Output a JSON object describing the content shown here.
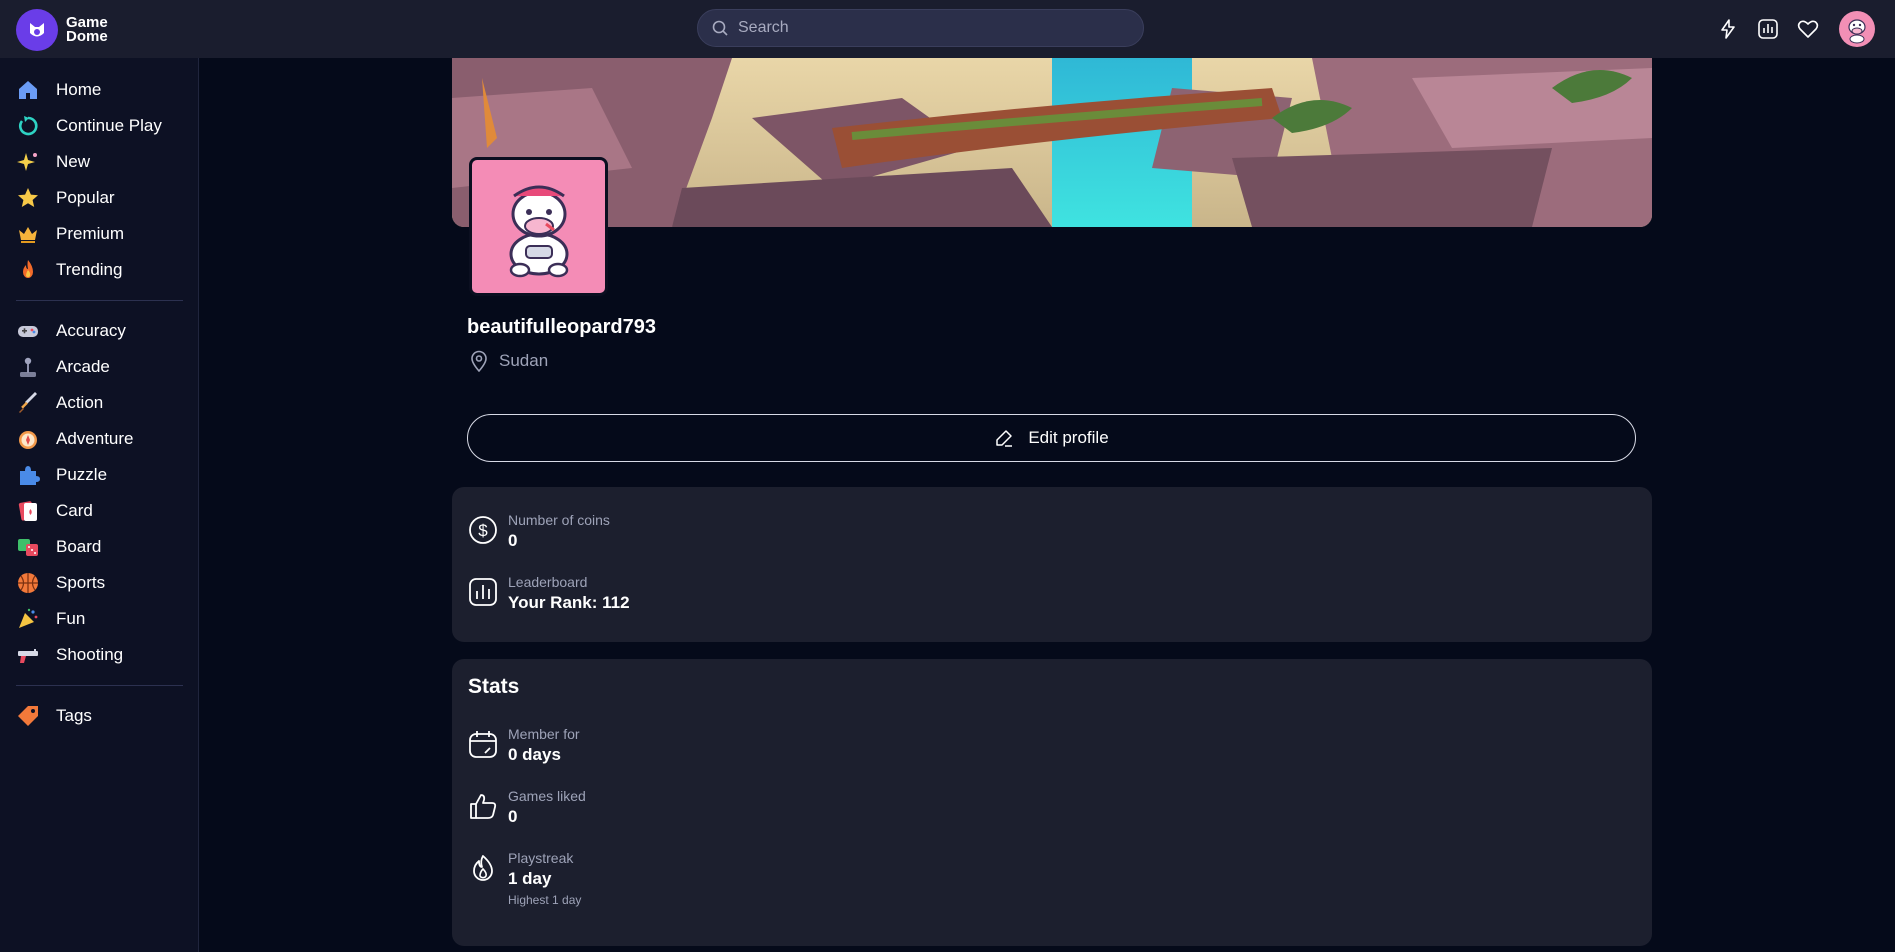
{
  "header": {
    "logo_text": "Game\nDome",
    "search_placeholder": "Search",
    "icons": [
      "lightning-icon",
      "chart-icon",
      "heart-icon",
      "avatar"
    ]
  },
  "sidebar": {
    "primary": [
      {
        "label": "Home",
        "icon": "home-icon"
      },
      {
        "label": "Continue Play",
        "icon": "continue-play-icon"
      },
      {
        "label": "New",
        "icon": "sparkle-icon"
      },
      {
        "label": "Popular",
        "icon": "star-icon"
      },
      {
        "label": "Premium",
        "icon": "crown-icon"
      },
      {
        "label": "Trending",
        "icon": "fire-icon"
      }
    ],
    "categories": [
      {
        "label": "Accuracy",
        "icon": "gamepad-icon"
      },
      {
        "label": "Arcade",
        "icon": "joystick-icon"
      },
      {
        "label": "Action",
        "icon": "sword-icon"
      },
      {
        "label": "Adventure",
        "icon": "compass-icon"
      },
      {
        "label": "Puzzle",
        "icon": "puzzle-icon"
      },
      {
        "label": "Card",
        "icon": "card-icon"
      },
      {
        "label": "Board",
        "icon": "dice-icon"
      },
      {
        "label": "Sports",
        "icon": "basketball-icon"
      },
      {
        "label": "Fun",
        "icon": "party-icon"
      },
      {
        "label": "Shooting",
        "icon": "gun-icon"
      }
    ],
    "tags": {
      "label": "Tags",
      "icon": "tag-icon"
    }
  },
  "profile": {
    "username": "beautifulleopard793",
    "location": "Sudan",
    "edit_label": "Edit profile"
  },
  "overview": {
    "coins_label": "Number of coins",
    "coins_value": "0",
    "leaderboard_label": "Leaderboard",
    "leaderboard_value": "Your Rank: 112"
  },
  "stats": {
    "title": "Stats",
    "member_label": "Member for",
    "member_value": "0 days",
    "liked_label": "Games liked",
    "liked_value": "0",
    "streak_label": "Playstreak",
    "streak_value": "1 day",
    "streak_sub": "Highest 1 day"
  },
  "colors": {
    "accent": "#6a3de8",
    "background": "#050a1a",
    "card": "#1c1f2e",
    "avatar_bg": "#f48cb6"
  }
}
